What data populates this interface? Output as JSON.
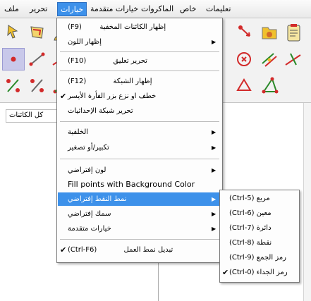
{
  "menubar": {
    "help": "تعليمات",
    "special": "خاص",
    "macros": "الماكروات",
    "advanced": "خيارات متقدمة",
    "options": "خيارات",
    "edit": "تحرير",
    "file": "ملف"
  },
  "algebra": {
    "all_objects": "كل الكائنات"
  },
  "menu": {
    "show_hidden": "إظهار الكائنات المخفية",
    "show_hidden_key": "(F9)",
    "show_color": "إظهار اللون",
    "edit_comment": "تحرير تعليق",
    "edit_comment_key": "(F10)",
    "show_grid": "إظهار الشبكة",
    "show_grid_key": "(F12)",
    "drag_tooltip": "خطف او نزع بزر الفأرة الأيسر",
    "edit_coord_grid": "تحرير شبكة الإحداثيات",
    "background": "الخلفية",
    "zoom": "تكبير/أو تصغير",
    "default_color": "لون إفتراضي",
    "fill_points": "Fill points with Background Color",
    "default_point_style": "نمط النقط إفتراضي",
    "default_thickness": "سمك إفتراضي",
    "advanced_options": "خيارات متقدمة",
    "switch_work_mode": "تبديل نمط العمل",
    "switch_work_mode_key": "(Ctrl-F6)"
  },
  "submenu": {
    "square": "(Ctrl-5) مربع",
    "diamond": "(Ctrl-6) معين",
    "circle": "(Ctrl-7) دائرة",
    "dot": "(Ctrl-8) نقطة",
    "plus": "(Ctrl-9) رمز الجمع",
    "cross": "(Ctrl-0) رمز الجداء"
  },
  "icons": {
    "checkmark": "checkmark-icon",
    "submenu_arrow": "submenu-arrow-icon"
  },
  "colors": {
    "highlight": "#3d91ea",
    "tool_red": "#d22a2a",
    "tool_yellow": "#f0c12e"
  }
}
